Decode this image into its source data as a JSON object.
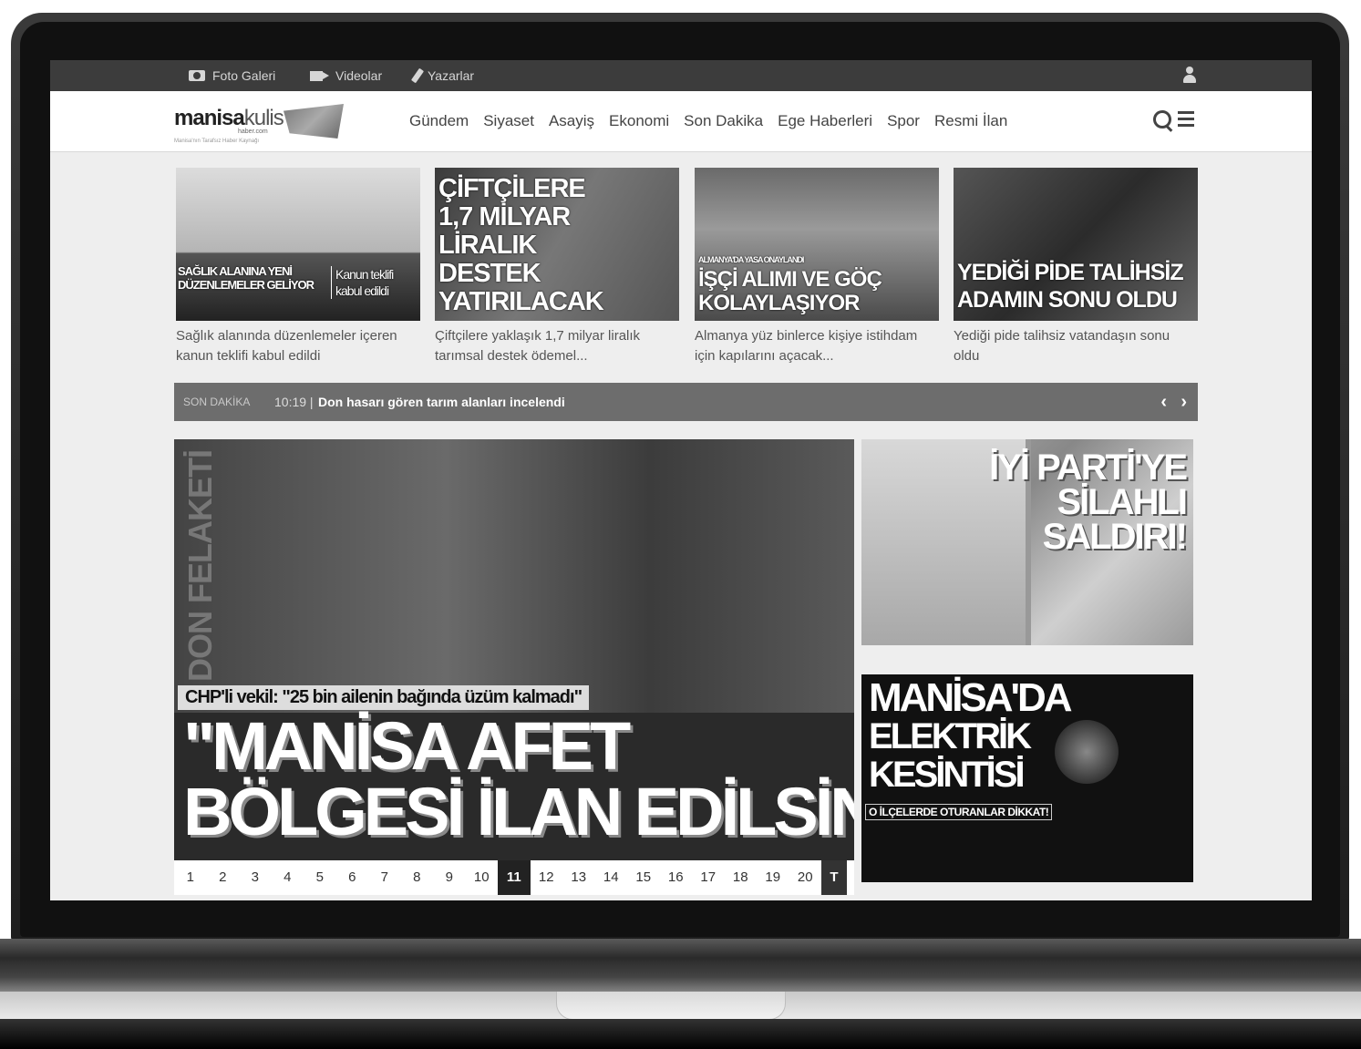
{
  "topbar": {
    "links": [
      {
        "label": "Foto Galeri",
        "icon": "camera-icon"
      },
      {
        "label": "Videolar",
        "icon": "video-icon"
      },
      {
        "label": "Yazarlar",
        "icon": "pen-icon"
      }
    ],
    "user_icon": "user-icon"
  },
  "logo": {
    "text_a": "manisa",
    "text_b": "kulis",
    "domain": "haber.com",
    "slogan": "Manisa'nın Tarafsız Haber Kaynağı"
  },
  "nav": {
    "items": [
      "Gündem",
      "Siyaset",
      "Asayiş",
      "Ekonomi",
      "Son Dakika",
      "Ege Haberleri",
      "Spor",
      "Resmi İlan"
    ],
    "search_icon": "search-icon",
    "menu_icon": "menu-icon"
  },
  "cards": [
    {
      "overlay_a": "SAĞLIK ALANINA YENİ DÜZENLEMELER GELİYOR",
      "overlay_b": "Kanun teklifi kabul edildi",
      "caption": "Sağlık alanında düzenlemeler içeren kanun teklifi kabul edildi"
    },
    {
      "overlay_a": "ÇİFTÇİLERE 1,7 MİLYAR LİRALIK DESTEK YATIRILACAK",
      "overlay_b": "",
      "caption": "Çiftçilere yaklaşık 1,7 milyar liralık tarımsal destek ödemel..."
    },
    {
      "overlay_a": "ALMANYA'DA YASA ONAYLANDI",
      "overlay_b": "İŞÇİ ALIMI VE GÖÇ KOLAYLAŞIYOR",
      "caption": "Almanya yüz binlerce kişiye istihdam için kapılarını açacak..."
    },
    {
      "overlay_a": "YEDİĞİ PİDE TALİHSİZ ADAMIN SONU OLDU",
      "overlay_b": "",
      "caption": "Yediği pide talihsiz vatandaşın sonu oldu"
    }
  ],
  "ticker": {
    "label": "SON DAKİKA",
    "time": "10:19 |",
    "text": "Don hasarı gören tarım alanları incelendi",
    "prev": "‹",
    "next": "›"
  },
  "hero": {
    "vertical": "DON FELAKETİ",
    "subtitle": "CHP'li vekil: \"25 bin ailenin bağında üzüm kalmadı\"",
    "title_line1": "\"MANİSA AFET",
    "title_line2": "BÖLGESİ İLAN EDİLSİN\""
  },
  "pager": {
    "pages": [
      "1",
      "2",
      "3",
      "4",
      "5",
      "6",
      "7",
      "8",
      "9",
      "10",
      "11",
      "12",
      "13",
      "14",
      "15",
      "16",
      "17",
      "18",
      "19",
      "20"
    ],
    "active": "11",
    "all_label": "T"
  },
  "side": [
    {
      "title": "İYİ PARTİ'YE SİLAHLI SALDIRI!"
    },
    {
      "title_a": "MANİSA'DA",
      "title_b": "ELEKTRİK",
      "title_c": "KESİNTİSİ",
      "note": "O İLÇELERDE OTURANLAR DİKKAT!"
    }
  ]
}
